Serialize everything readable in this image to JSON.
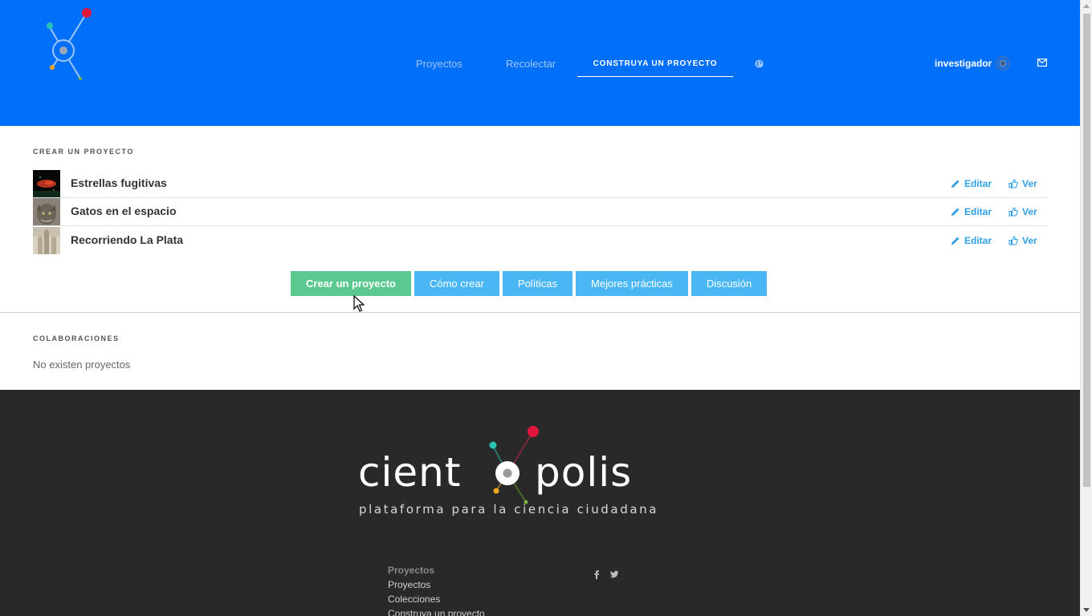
{
  "header": {
    "nav": [
      {
        "label": "Proyectos"
      },
      {
        "label": "Recolectar"
      },
      {
        "label": "CONSTRUYA UN PROYECTO"
      }
    ],
    "user": {
      "name": "investigador"
    }
  },
  "my_projects": {
    "section_title": "CREAR UN PROYECTO",
    "items": [
      {
        "name": "Estrellas fugitivas",
        "edit_label": "Editar",
        "view_label": "Ver"
      },
      {
        "name": "Gatos en el espacio",
        "edit_label": "Editar",
        "view_label": "Ver"
      },
      {
        "name": "Recorriendo La Plata",
        "edit_label": "Editar",
        "view_label": "Ver"
      }
    ],
    "buttons": {
      "create": "Crear un proyecto",
      "how_to": "Cómo crear",
      "policies": "Políticas",
      "best_practices": "Mejores prácticas",
      "discussion": "Discusión"
    }
  },
  "collaborations": {
    "section_title": "COLABORACIONES",
    "empty_text": "No existen proyectos"
  },
  "footer": {
    "brand_left": "cient",
    "brand_right": "polis",
    "tagline": "plataforma para la ciencia ciudadana",
    "column": {
      "heading": "Proyectos",
      "links": [
        "Proyectos",
        "Colecciones",
        "Construya un proyecto"
      ]
    }
  },
  "colors": {
    "header_bg": "#006ff9",
    "accent_blue": "#4ab6f4",
    "accent_green": "#5ac88f",
    "footer_bg": "#292929",
    "logo_red": "#e0173d",
    "logo_teal": "#27c2b2",
    "logo_orange": "#f5a623",
    "logo_green": "#7cb342"
  }
}
